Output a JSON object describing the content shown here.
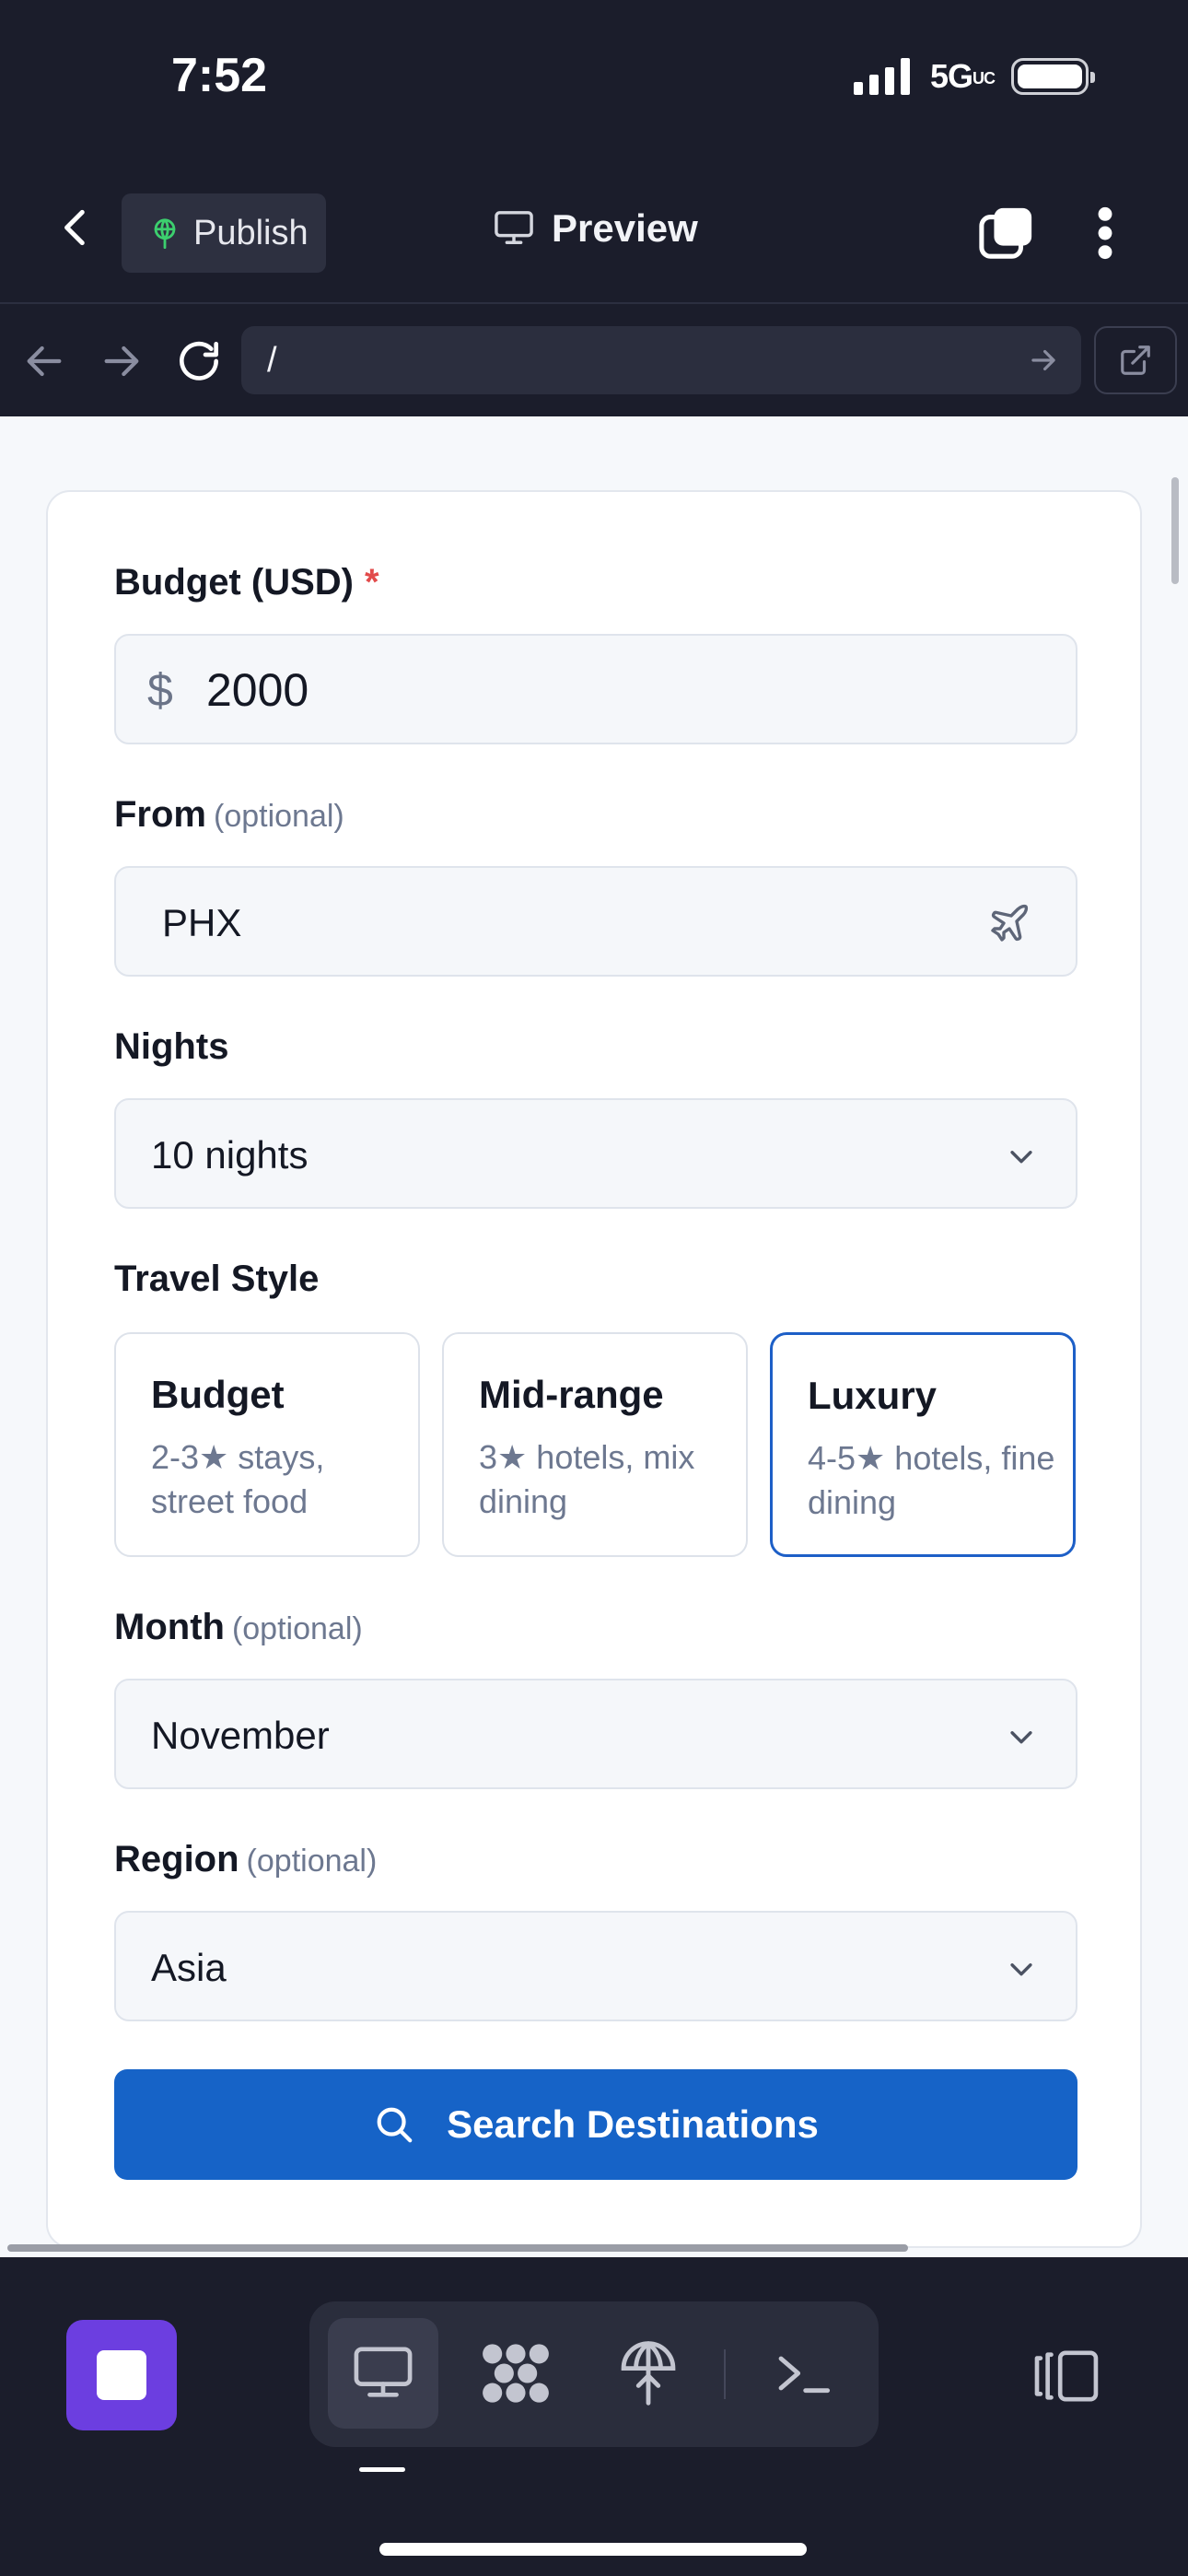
{
  "status_bar": {
    "time": "7:52",
    "network": "5G",
    "network_suffix": "UC"
  },
  "header": {
    "publish_label": "Publish",
    "preview_label": "Preview"
  },
  "browser": {
    "url": "/"
  },
  "form": {
    "budget": {
      "label": "Budget (USD)",
      "required_mark": "*",
      "currency_symbol": "$",
      "value": "2000"
    },
    "from": {
      "label": "From",
      "optional": "(optional)",
      "value": "PHX"
    },
    "nights": {
      "label": "Nights",
      "value": "10 nights"
    },
    "travel_style": {
      "label": "Travel Style",
      "options": [
        {
          "title": "Budget",
          "desc": "2-3★ stays, street food"
        },
        {
          "title": "Mid-range",
          "desc": "3★ hotels, mix dining"
        },
        {
          "title": "Luxury",
          "desc": "4-5★ hotels, fine dining"
        }
      ],
      "selected": "Luxury"
    },
    "month": {
      "label": "Month",
      "optional": "(optional)",
      "value": "November"
    },
    "region": {
      "label": "Region",
      "optional": "(optional)",
      "value": "Asia"
    },
    "search_label": "Search Destinations"
  },
  "colors": {
    "primary": "#1663c7",
    "selected_border": "#1d5fc7",
    "required": "#e24b4b",
    "stop_button": "#6c3ee0",
    "publish_icon": "#3ccf6e"
  },
  "icons": {
    "back": "chevron-left-icon",
    "publish": "globe-sprout-icon",
    "preview": "monitor-icon",
    "tabs": "tabs-icon",
    "more": "more-vertical-icon",
    "nav_back": "arrow-left-icon",
    "nav_forward": "arrow-right-icon",
    "reload": "reload-icon",
    "url_go": "arrow-right-icon",
    "open_external": "external-link-icon",
    "from_field": "plane-icon",
    "dropdown": "chevron-down-icon",
    "search": "search-icon",
    "toolbar": [
      "monitor-icon",
      "integrations-icon",
      "deploy-icon",
      "terminal-icon"
    ],
    "split_view": "split-view-icon"
  }
}
